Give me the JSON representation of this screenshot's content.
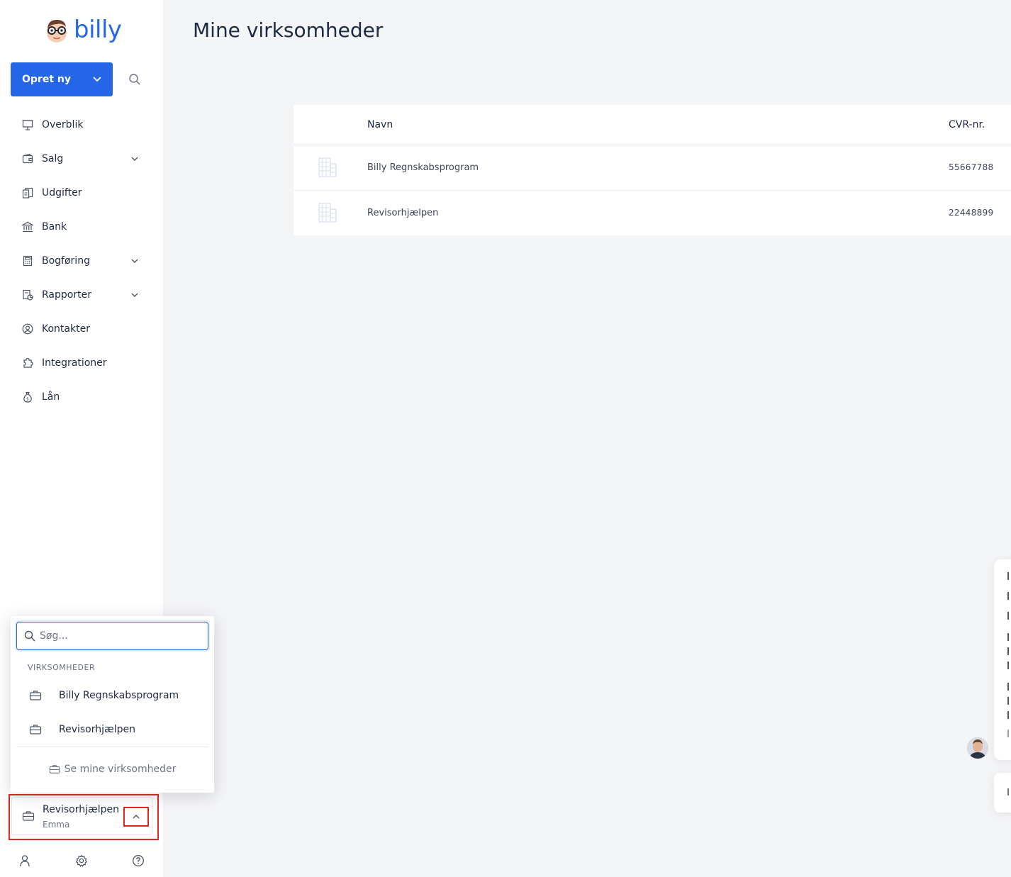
{
  "app": {
    "logo_text": "billy"
  },
  "sidebar": {
    "create_label": "Opret ny",
    "items": [
      {
        "label": "Overblik",
        "icon": "presentation-icon",
        "has_chevron": false
      },
      {
        "label": "Salg",
        "icon": "wallet-icon",
        "has_chevron": true
      },
      {
        "label": "Udgifter",
        "icon": "receipts-icon",
        "has_chevron": false
      },
      {
        "label": "Bank",
        "icon": "bank-icon",
        "has_chevron": false
      },
      {
        "label": "Bogføring",
        "icon": "calculator-icon",
        "has_chevron": true
      },
      {
        "label": "Rapporter",
        "icon": "report-icon",
        "has_chevron": true
      },
      {
        "label": "Kontakter",
        "icon": "user-circle-icon",
        "has_chevron": false
      },
      {
        "label": "Integrationer",
        "icon": "puzzle-icon",
        "has_chevron": false
      },
      {
        "label": "Lån",
        "icon": "money-bag-icon",
        "has_chevron": false
      }
    ],
    "company_selector": {
      "name": "Revisorhjælpen",
      "user": "Emma"
    }
  },
  "popup": {
    "search_placeholder": "Søg...",
    "section_label": "VIRKSOMHEDER",
    "companies": [
      "Billy Regnskabsprogram",
      "Revisorhjælpen"
    ],
    "footer_label": "Se mine virksomheder"
  },
  "main": {
    "title": "Mine virksomheder",
    "table": {
      "headers": {
        "name": "Navn",
        "cvr": "CVR-nr."
      },
      "rows": [
        {
          "name": "Billy Regnskabsprogram",
          "cvr": "55667788"
        },
        {
          "name": "Revisorhjælpen",
          "cvr": "22448899"
        }
      ]
    }
  },
  "colors": {
    "brand": "#2566e8",
    "highlight": "#e0281f",
    "text": "#1f2a44",
    "muted": "#6b7385"
  }
}
